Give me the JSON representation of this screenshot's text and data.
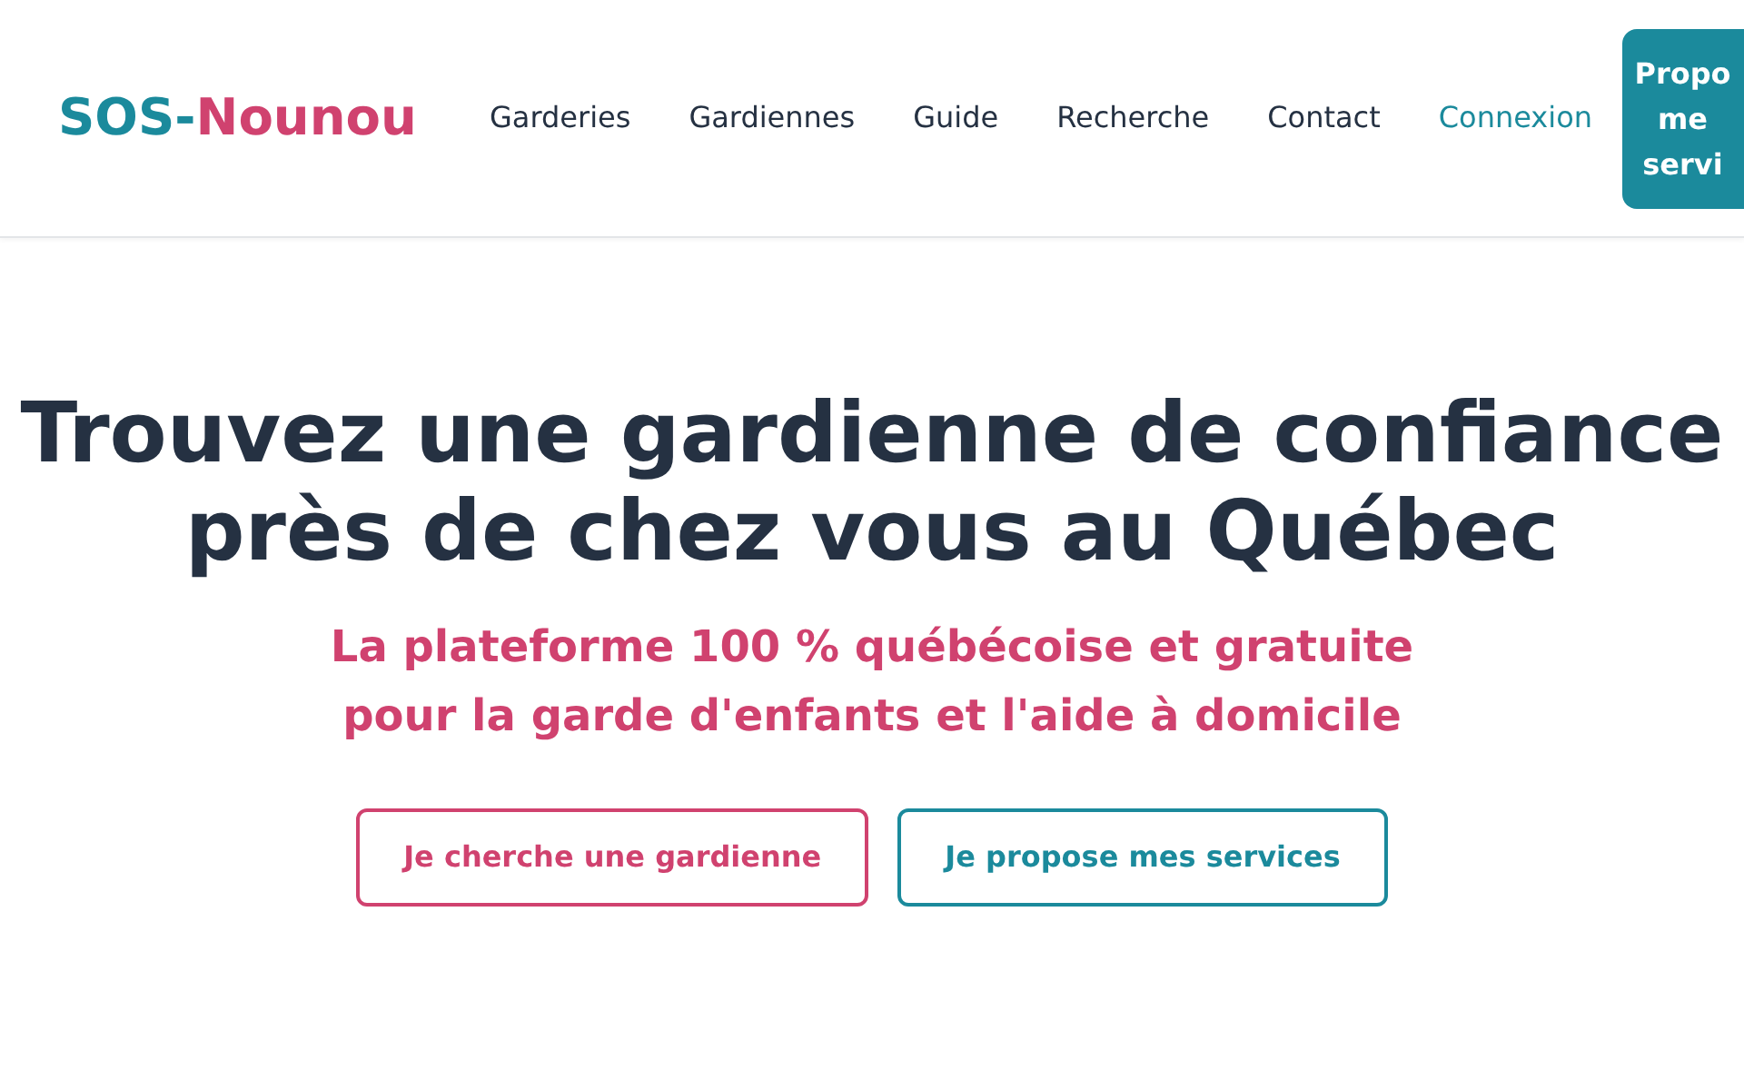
{
  "header": {
    "logo": {
      "first": "SOS-",
      "second": "Nounou"
    },
    "nav": [
      {
        "label": "Garderies",
        "kind": "link"
      },
      {
        "label": "Gardiennes",
        "kind": "link"
      },
      {
        "label": "Guide",
        "kind": "link"
      },
      {
        "label": "Recherche",
        "kind": "link"
      },
      {
        "label": "Contact",
        "kind": "link"
      },
      {
        "label": "Connexion",
        "kind": "accent"
      }
    ],
    "cta": "Propo me servi"
  },
  "hero": {
    "title_lines": [
      "Trouvez une gardienne de confiance",
      "près de chez vous au Québec"
    ],
    "subtitle_lines": [
      "La plateforme 100 % québécoise et gratuite",
      "pour la garde d'enfants et l'aide à domicile"
    ],
    "buttons": [
      {
        "label": "Je cherche une gardienne",
        "color": "#d0426f"
      },
      {
        "label": "Je propose mes services",
        "color": "#1b8a9c"
      }
    ]
  }
}
